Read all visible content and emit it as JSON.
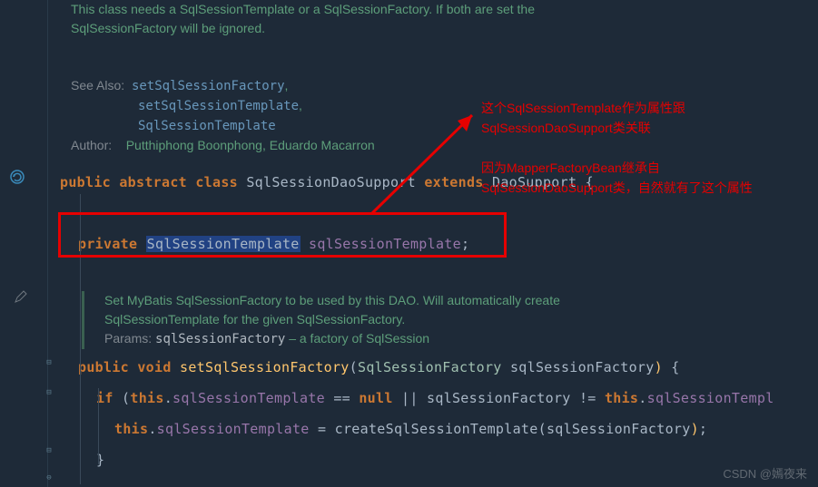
{
  "javadoc1": {
    "line1": "This class needs a SqlSessionTemplate or a SqlSessionFactory. If both are set the",
    "line2": "SqlSessionFactory will be ignored.",
    "seealso_label": "See Also:",
    "seealso1": "setSqlSessionFactory",
    "seealso2": "setSqlSessionTemplate",
    "seealso3": "SqlSessionTemplate",
    "author_label": "Author:",
    "author_value": "Putthiphong Boonphong, Eduardo Macarron"
  },
  "code": {
    "kw_public": "public",
    "kw_abstract": "abstract",
    "kw_class": "class",
    "classname": "SqlSessionDaoSupport",
    "kw_extends": "extends",
    "superclass": "DaoSupport",
    "brace_open": "{",
    "kw_private": "private",
    "field_type": "SqlSessionTemplate",
    "field_name": "sqlSessionTemplate",
    "semicolon": ";"
  },
  "javadoc2": {
    "line1": "Set MyBatis SqlSessionFactory to be used by this DAO. Will automatically create",
    "line2": "SqlSessionTemplate for the given SqlSessionFactory.",
    "params_label": "Params:",
    "param_name": "sqlSessionFactory",
    "param_desc": " – a factory of SqlSession"
  },
  "method": {
    "kw_public": "public",
    "kw_void": "void",
    "name": "setSqlSessionFactory",
    "paren_o": "(",
    "param_type": "SqlSessionFactory",
    "param_name": "sqlSessionFactory",
    "paren_c": ")",
    "brace_o": "{",
    "kw_if": "if",
    "kw_this": "this",
    "dot": ".",
    "field": "sqlSessionTemplate",
    "eqeq": " == ",
    "kw_null": "null",
    "or": " || ",
    "neq": " != ",
    "eq": " = ",
    "call": "createSqlSessionTemplate",
    "brace_c": "}",
    "semicolon": ";",
    "tail_type": "sqlSessionTempl"
  },
  "annotations": {
    "a1_l1": "这个SqlSessionTemplate作为属性跟",
    "a1_l2": "SqlSessionDaoSupport类关联",
    "a2_l1": "因为MapperFactoryBean继承自",
    "a2_l2": "SqlSessionDaoSupport类，自然就有了这个属性"
  },
  "watermark": "CSDN @嫣夜来"
}
